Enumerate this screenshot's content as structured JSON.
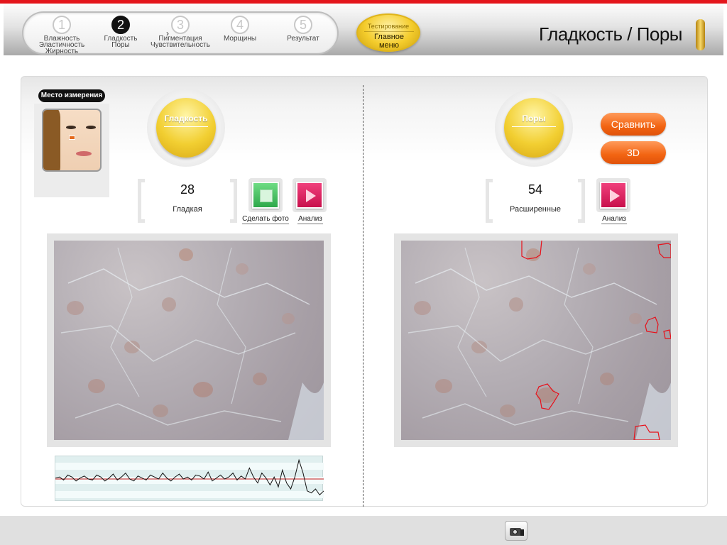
{
  "header": {
    "steps": [
      {
        "num": "1",
        "label": "Влажность\nЭластичность\nЖирность",
        "active": false
      },
      {
        "num": "2",
        "label": "Гладкость\nПоры",
        "active": true
      },
      {
        "num": "3",
        "label": "Пигментация\nЧувствительность",
        "active": false
      },
      {
        "num": "4",
        "label": "Морщины",
        "active": false
      },
      {
        "num": "5",
        "label": "Результат",
        "active": false
      }
    ],
    "menu_button": {
      "small": "Тестирование",
      "main": "Главное меню"
    },
    "page_title": "Гладкость / Поры"
  },
  "left": {
    "location_badge": "Место измерения",
    "main_button": "Гладкость",
    "score": "28",
    "score_label": "Гладкая",
    "photo_button": "Сделать фото",
    "analyze_button": "Анализ",
    "graph_values": [
      0.05,
      0.1,
      -0.05,
      0.2,
      0.1,
      -0.1,
      0.05,
      0.15,
      0.0,
      -0.05,
      0.2,
      0.1,
      -0.1,
      0.05,
      0.25,
      -0.05,
      0.1,
      0.3,
      0.0,
      -0.1,
      0.15,
      0.05,
      -0.05,
      0.2,
      0.1,
      0.0,
      0.3,
      0.05,
      -0.1,
      0.1,
      0.25,
      0.0,
      0.1,
      -0.05,
      0.2,
      0.15,
      0.0,
      0.35,
      -0.1,
      0.05,
      0.2,
      0.0,
      0.1,
      0.3,
      -0.05,
      0.15,
      0.0,
      0.55,
      0.1,
      -0.2,
      0.3,
      0.05,
      -0.3,
      0.1,
      -0.4,
      0.45,
      -0.2,
      -0.5,
      0.1,
      0.95,
      0.3,
      -0.6,
      -0.7,
      -0.5,
      -0.8,
      -0.6
    ]
  },
  "right": {
    "main_button": "Поры",
    "score": "54",
    "score_label": "Расширенные",
    "analyze_button": "Анализ",
    "compare_button": "Сравнить",
    "view3d_button": "3D"
  },
  "colors": {
    "accent_red": "#e4161c",
    "gold": "#f2cf32",
    "orange": "#f26412",
    "pore_outline": "#e8101a"
  },
  "icons": {
    "footer_camera": "camera-icon",
    "photo": "stop-square-icon",
    "analyze": "play-icon"
  }
}
